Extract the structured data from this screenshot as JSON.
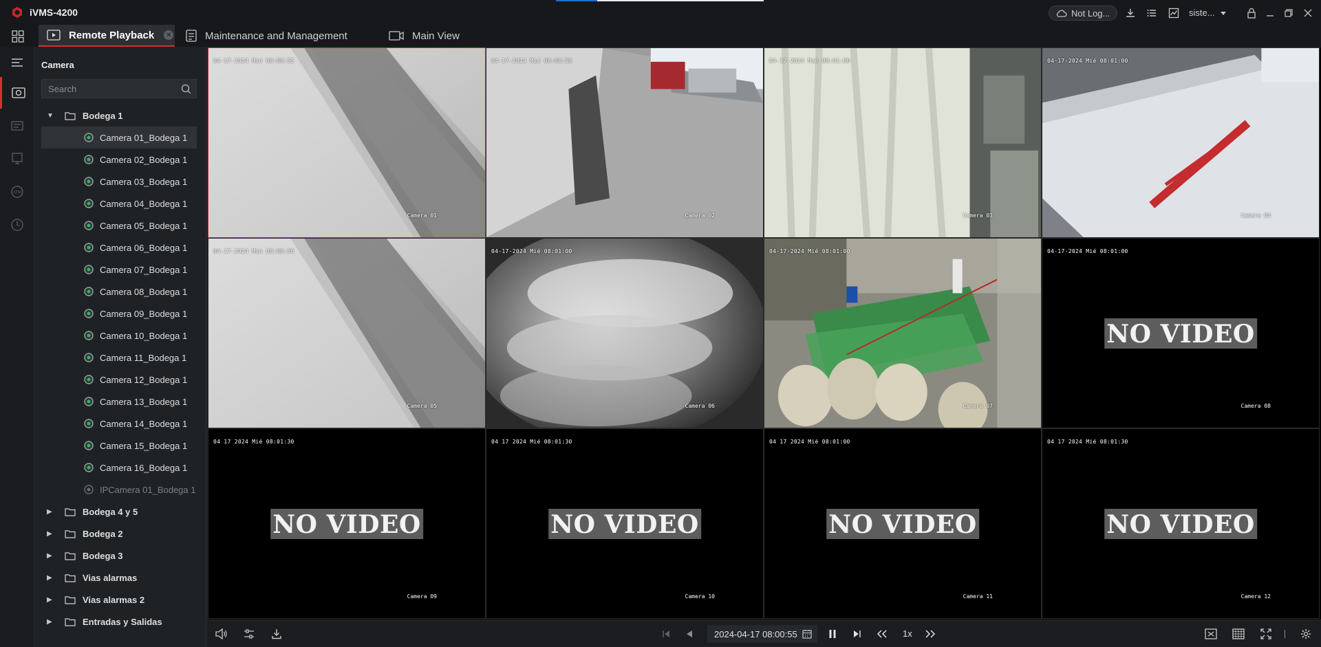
{
  "app": {
    "name": "iVMS-4200"
  },
  "titlebar": {
    "account_status": "Not Log...",
    "user": "siste..."
  },
  "tabs": [
    {
      "label": "Remote Playback",
      "active": true
    },
    {
      "label": "Maintenance and Management",
      "active": false
    },
    {
      "label": "Main View",
      "active": false
    }
  ],
  "panel": {
    "title": "Camera",
    "search_placeholder": "Search"
  },
  "tree": {
    "group_open": "Bodega 1",
    "cameras": [
      "Camera 01_Bodega 1",
      "Camera 02_Bodega 1",
      "Camera 03_Bodega 1",
      "Camera 04_Bodega 1",
      "Camera 05_Bodega 1",
      "Camera 06_Bodega 1",
      "Camera 07_Bodega 1",
      "Camera 08_Bodega 1",
      "Camera 09_Bodega 1",
      "Camera 10_Bodega 1",
      "Camera 11_Bodega 1",
      "Camera 12_Bodega 1",
      "Camera 13_Bodega 1",
      "Camera 14_Bodega 1",
      "Camera 15_Bodega 1",
      "Camera 16_Bodega 1"
    ],
    "ipcamera": "IPCamera 01_Bodega 1",
    "groups_closed": [
      "Bodega 4 y 5",
      "Bodega 2",
      "Bodega 3",
      "Vias alarmas",
      "Vias alarmas 2",
      "Entradas y Salidas"
    ]
  },
  "tiles": [
    {
      "time": "04-17-2024 Mié 08:00:55",
      "name": "Camera 01",
      "novideo": false,
      "scene": "warehouse-corridor"
    },
    {
      "time": "04-17-2024 Mié 08:00:55",
      "name": "Camera 02",
      "novideo": false,
      "scene": "loading-yard"
    },
    {
      "time": "04-17-2024 Mié 08:01:00",
      "name": "Camera 03",
      "novideo": false,
      "scene": "curtain-sacks"
    },
    {
      "time": "04-17-2024 Mié 08:01:00",
      "name": "Camera 04",
      "novideo": false,
      "scene": "truck-trailer"
    },
    {
      "time": "04-17-2024 Mié 08:00:56",
      "name": "Camera 05",
      "novideo": false,
      "scene": "warehouse-corridor"
    },
    {
      "time": "04-17-2024 Mié 08:01:00",
      "name": "Camera 06",
      "novideo": false,
      "scene": "sacks-closeup"
    },
    {
      "time": "04-17-2024 Mié 08:01:00",
      "name": "Camera 07",
      "novideo": false,
      "scene": "workshop"
    },
    {
      "time": "04-17-2024 Mié 08:01:00",
      "name": "Camera 08",
      "novideo": true
    },
    {
      "time": "04 17 2024 Mié 08:01:30",
      "name": "Camera 09",
      "novideo": true
    },
    {
      "time": "04 17 2024 Mié 08:01:30",
      "name": "Camera 10",
      "novideo": true
    },
    {
      "time": "04 17 2024 Mié 08:01:00",
      "name": "Camera 11",
      "novideo": true
    },
    {
      "time": "04 17 2024 Mié 08:01:30",
      "name": "Camera 12",
      "novideo": true
    }
  ],
  "novideo_text": "NO VIDEO",
  "playback": {
    "datetime": "2024-04-17 08:00:55",
    "speed": "1x"
  },
  "colors": {
    "accent": "#d43131",
    "bg": "#1e2023",
    "panel": "#1f2225"
  }
}
